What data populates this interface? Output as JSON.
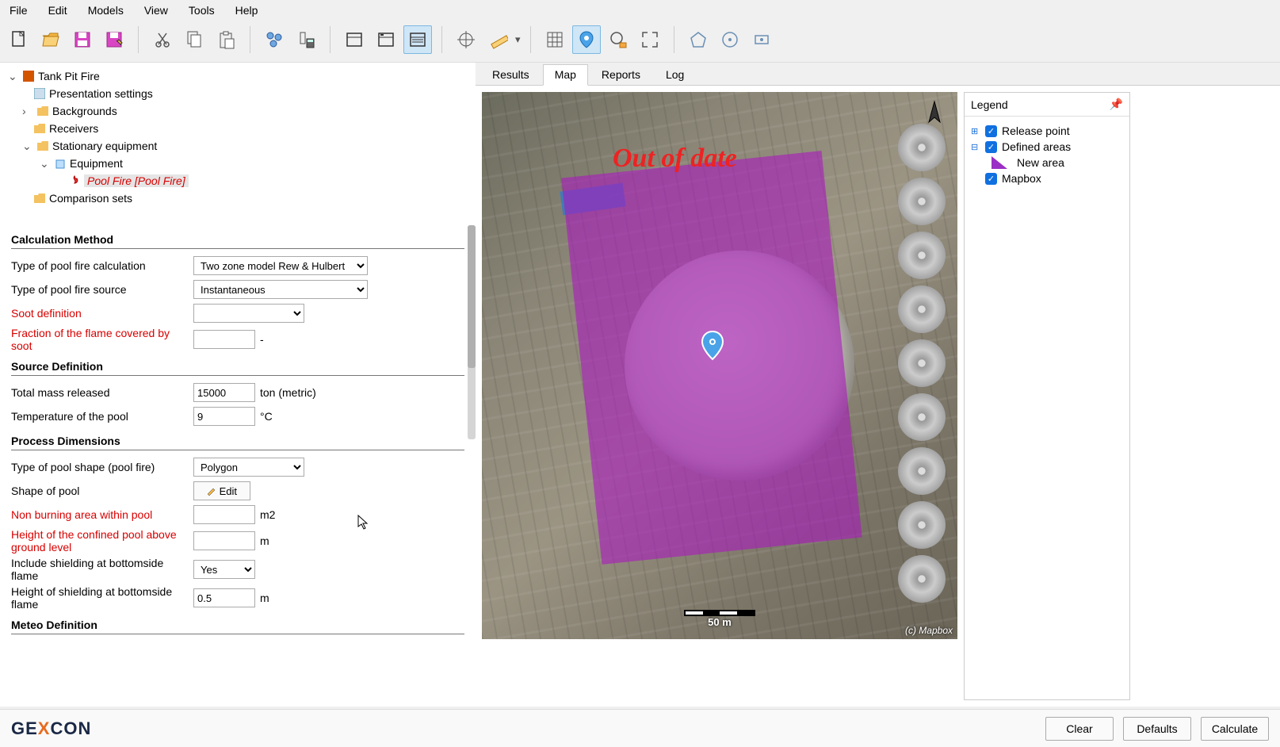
{
  "menu": {
    "items": [
      "File",
      "Edit",
      "Models",
      "View",
      "Tools",
      "Help"
    ]
  },
  "tree": {
    "root": "Tank Pit Fire",
    "presentation": "Presentation settings",
    "backgrounds": "Backgrounds",
    "receivers": "Receivers",
    "stationary": "Stationary equipment",
    "equipment": "Equipment",
    "pool_fire": "Pool Fire [Pool Fire]",
    "comparison": "Comparison sets"
  },
  "props": {
    "h_calc": "Calculation Method",
    "h_source": "Source Definition",
    "h_process": "Process Dimensions",
    "h_meteo": "Meteo Definition",
    "lbl_calc_type": "Type of pool fire calculation",
    "lbl_source_type": "Type of pool fire source",
    "lbl_soot": "Soot definition",
    "lbl_fraction": "Fraction of the flame covered by soot",
    "lbl_mass": "Total mass released",
    "lbl_temp": "Temperature of the pool",
    "lbl_shape_type": "Type of pool shape (pool fire)",
    "lbl_shape": "Shape of pool",
    "lbl_nonburn": "Non burning area within pool",
    "lbl_height_conf": "Height of the confined pool above ground level",
    "lbl_shield_inc": "Include shielding at bottomside flame",
    "lbl_shield_h": "Height of shielding at bottomside flame",
    "val_calc_type": "Two zone model Rew & Hulbert",
    "val_source_type": "Instantaneous",
    "val_soot": "",
    "val_fraction": "",
    "val_mass": "15000",
    "val_temp": "9",
    "val_shape_type": "Polygon",
    "val_shield_inc": "Yes",
    "val_shield_h": "0.5",
    "val_nonburn": "",
    "val_height_conf": "",
    "u_ton": "ton (metric)",
    "u_c": "°C",
    "u_m2": "m2",
    "u_m": "m",
    "u_dash": "-",
    "edit_btn": "Edit"
  },
  "tabs": {
    "results": "Results",
    "map": "Map",
    "reports": "Reports",
    "log": "Log"
  },
  "legend": {
    "title": "Legend",
    "release": "Release point",
    "areas": "Defined areas",
    "newarea": "New area",
    "mapbox": "Mapbox"
  },
  "map": {
    "warn": "Out of date",
    "scale": "50 m",
    "attrib": "(c) Mapbox"
  },
  "footer": {
    "clear": "Clear",
    "defaults": "Defaults",
    "calculate": "Calculate"
  }
}
